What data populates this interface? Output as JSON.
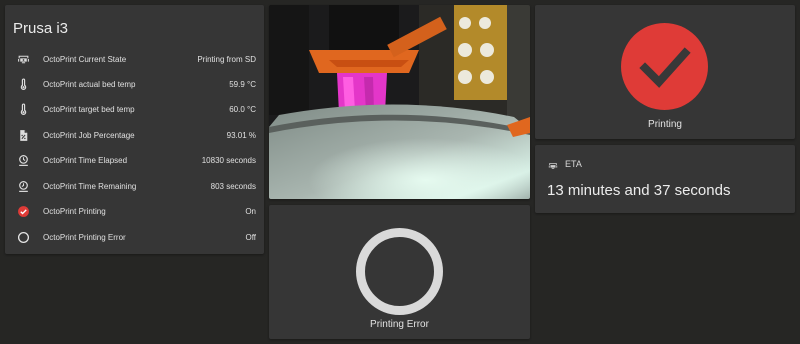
{
  "entities_card": {
    "title": "Prusa i3",
    "rows": [
      {
        "icon": "printer-3d-icon",
        "name": "OctoPrint Current State",
        "state": "Printing from SD"
      },
      {
        "icon": "thermometer-icon",
        "name": "OctoPrint actual bed temp",
        "state": "59.9 °C"
      },
      {
        "icon": "thermometer-icon",
        "name": "OctoPrint target bed temp",
        "state": "60.0 °C"
      },
      {
        "icon": "file-percent-icon",
        "name": "OctoPrint Job Percentage",
        "state": "93.01 %"
      },
      {
        "icon": "clock-start-icon",
        "name": "OctoPrint Time Elapsed",
        "state": "10830 seconds"
      },
      {
        "icon": "clock-end-icon",
        "name": "OctoPrint Time Remaining",
        "state": "803 seconds"
      },
      {
        "icon": "check-circle-icon",
        "name": "OctoPrint Printing",
        "state": "On"
      },
      {
        "icon": "circle-outline-icon",
        "name": "OctoPrint Printing Error",
        "state": "Off"
      }
    ]
  },
  "printing_card": {
    "label": "Printing",
    "icon": "check-circle-icon",
    "color": "#df3b37"
  },
  "error_card": {
    "label": "Printing Error",
    "icon": "circle-outline-icon"
  },
  "eta_card": {
    "icon": "printer-3d-icon",
    "name": "ETA",
    "value": "13 minutes and 37 seconds"
  },
  "colors": {
    "background": "#262624",
    "card": "#363636",
    "accent_red": "#df3b37"
  }
}
